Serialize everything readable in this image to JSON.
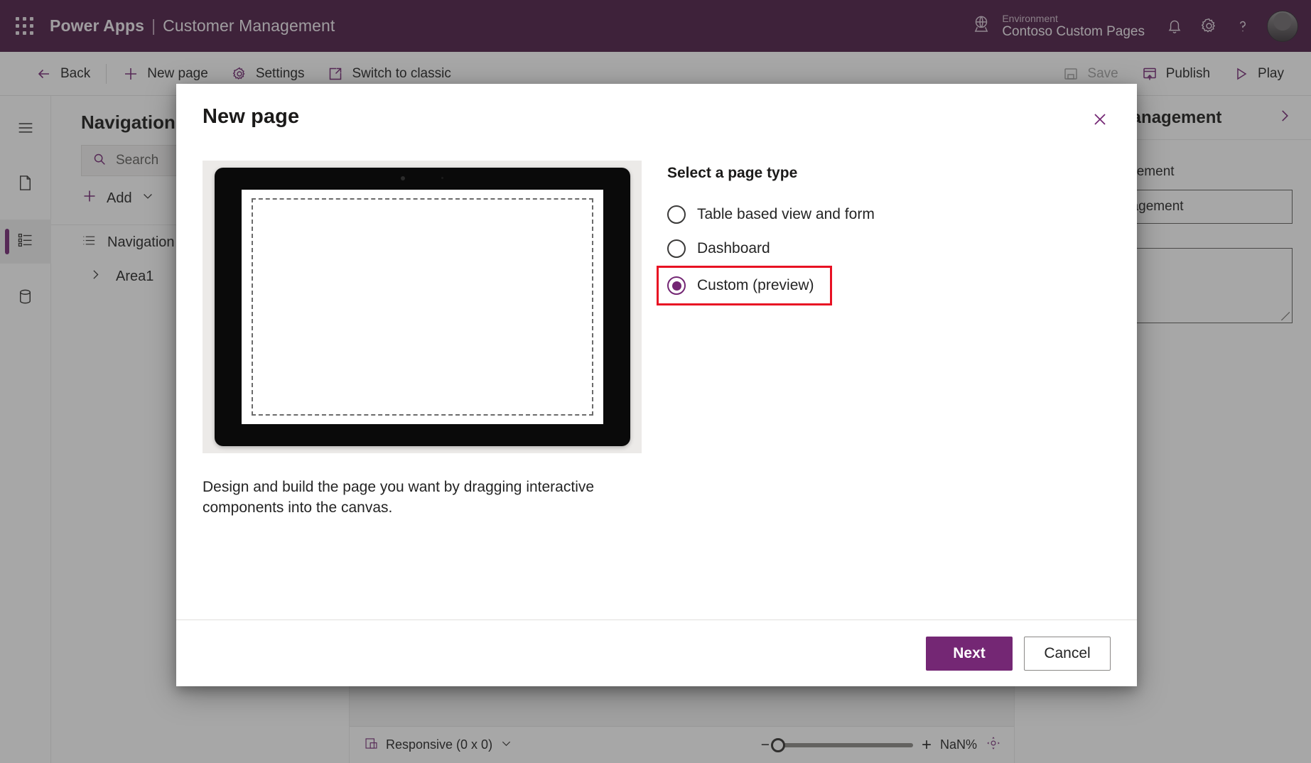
{
  "header": {
    "waffle_icon": "app-launcher-icon",
    "brand": "Power Apps",
    "separator": "|",
    "app_name": "Customer Management",
    "environment_label": "Environment",
    "environment_name": "Contoso Custom Pages",
    "globe_icon": "globe-icon",
    "notification_icon": "bell-icon",
    "settings_icon": "gear-icon",
    "help_icon": "question-mark-icon",
    "avatar": "user-avatar"
  },
  "commandbar": {
    "back": "Back",
    "new_page": "New page",
    "settings": "Settings",
    "switch_to_classic": "Switch to classic",
    "save": "Save",
    "publish": "Publish",
    "play": "Play"
  },
  "rail": {
    "items": [
      {
        "name": "hamburger-menu-icon",
        "label": "Menu"
      },
      {
        "name": "pages-icon",
        "label": "Pages"
      },
      {
        "name": "navigation-icon",
        "label": "Navigation"
      },
      {
        "name": "data-icon",
        "label": "Data"
      }
    ]
  },
  "tree": {
    "title": "Navigation",
    "search_placeholder": "Search",
    "add_label": "Add",
    "items": [
      {
        "label": "Navigation",
        "icon": "list-icon",
        "level": 0
      },
      {
        "label": "Area1",
        "icon": "chevron-right-icon",
        "level": 1
      }
    ]
  },
  "status": {
    "responsive_label": "Responsive (0 x 0)",
    "zoom_minus": "−",
    "zoom_plus": "+",
    "zoom_value": "NaN%",
    "fit_icon": "fit-to-screen-icon"
  },
  "properties": {
    "title": "Customer Management",
    "expand_icon": "chevron-right-icon",
    "field_label": "Customer Management",
    "field_value": "Customer Management",
    "description_value": ""
  },
  "modal": {
    "title": "New page",
    "close_icon": "close-icon",
    "preview_description": "Design and build the page you want by dragging interactive components into the canvas.",
    "options_title": "Select a page type",
    "options": [
      {
        "label": "Table based view and form",
        "selected": false
      },
      {
        "label": "Dashboard",
        "selected": false
      },
      {
        "label": "Custom (preview)",
        "selected": true,
        "highlighted": true
      }
    ],
    "next_label": "Next",
    "cancel_label": "Cancel"
  },
  "colors": {
    "brand_purple": "#4a1a44",
    "accent_purple": "#742774",
    "highlight_red": "#e81123"
  }
}
